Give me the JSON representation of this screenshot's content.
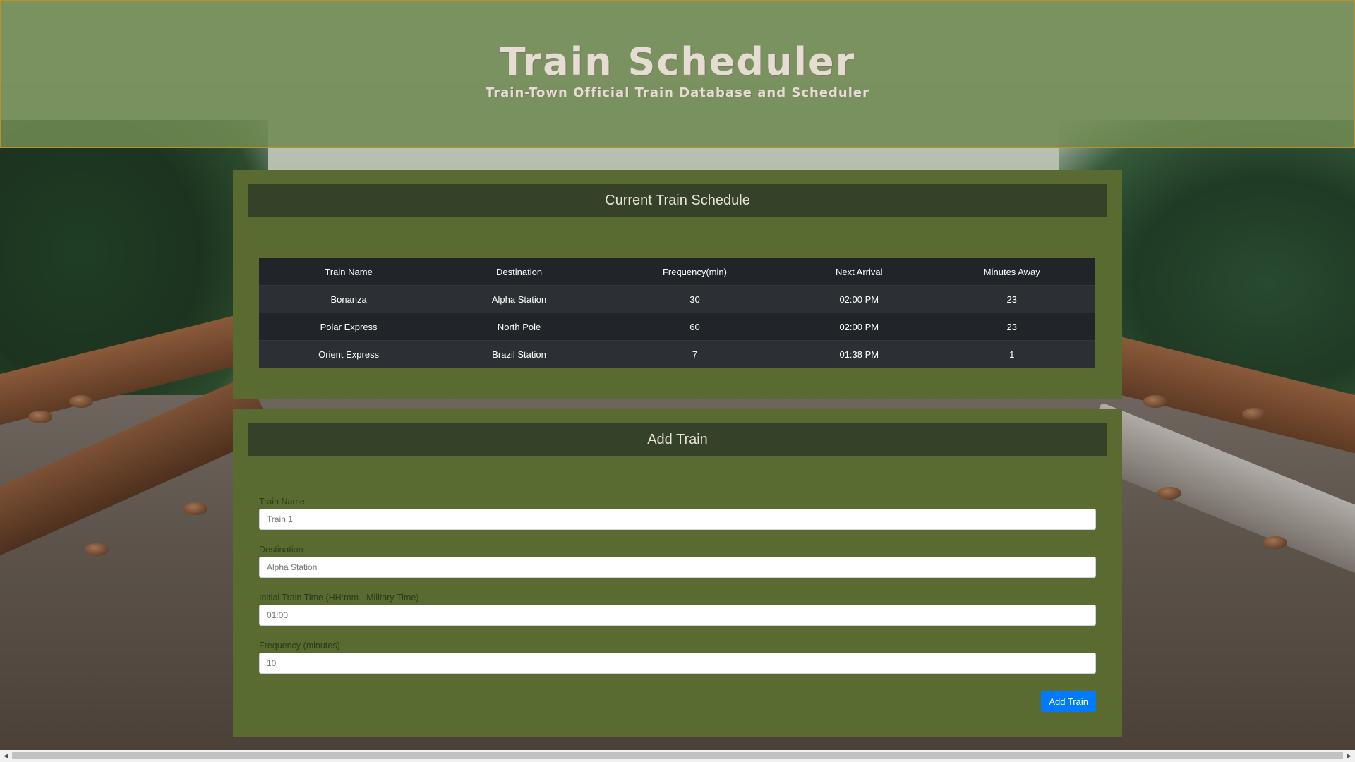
{
  "header": {
    "title": "Train Scheduler",
    "subtitle": "Train-Town Official Train Database and Scheduler"
  },
  "schedule": {
    "heading": "Current Train Schedule",
    "columns": [
      "Train Name",
      "Destination",
      "Frequency(min)",
      "Next Arrival",
      "Minutes Away"
    ],
    "rows": [
      [
        "Bonanza",
        "Alpha Station",
        "30",
        "02:00 PM",
        "23"
      ],
      [
        "Polar Express",
        "North Pole",
        "60",
        "02:00 PM",
        "23"
      ],
      [
        "Orient Express",
        "Brazil Station",
        "7",
        "01:38 PM",
        "1"
      ]
    ]
  },
  "add_train": {
    "heading": "Add Train",
    "fields": [
      {
        "label": "Train Name",
        "placeholder": "Train 1"
      },
      {
        "label": "Destination",
        "placeholder": "Alpha Station"
      },
      {
        "label": "Initial Train Time (HH:mm - Military Time)",
        "placeholder": "01:00"
      },
      {
        "label": "Frequency (minutes)",
        "placeholder": "10"
      }
    ],
    "submit_label": "Add Train"
  },
  "scrollbar": {
    "left_arrow": "◀",
    "right_arrow": "▶"
  },
  "colors": {
    "header_bg": "#708a52",
    "header_border": "#b8912c",
    "panel_bg": "#5a6b31",
    "panel_heading_bg": "#354128",
    "table_dark": "#212529",
    "button_primary": "#007bff"
  }
}
